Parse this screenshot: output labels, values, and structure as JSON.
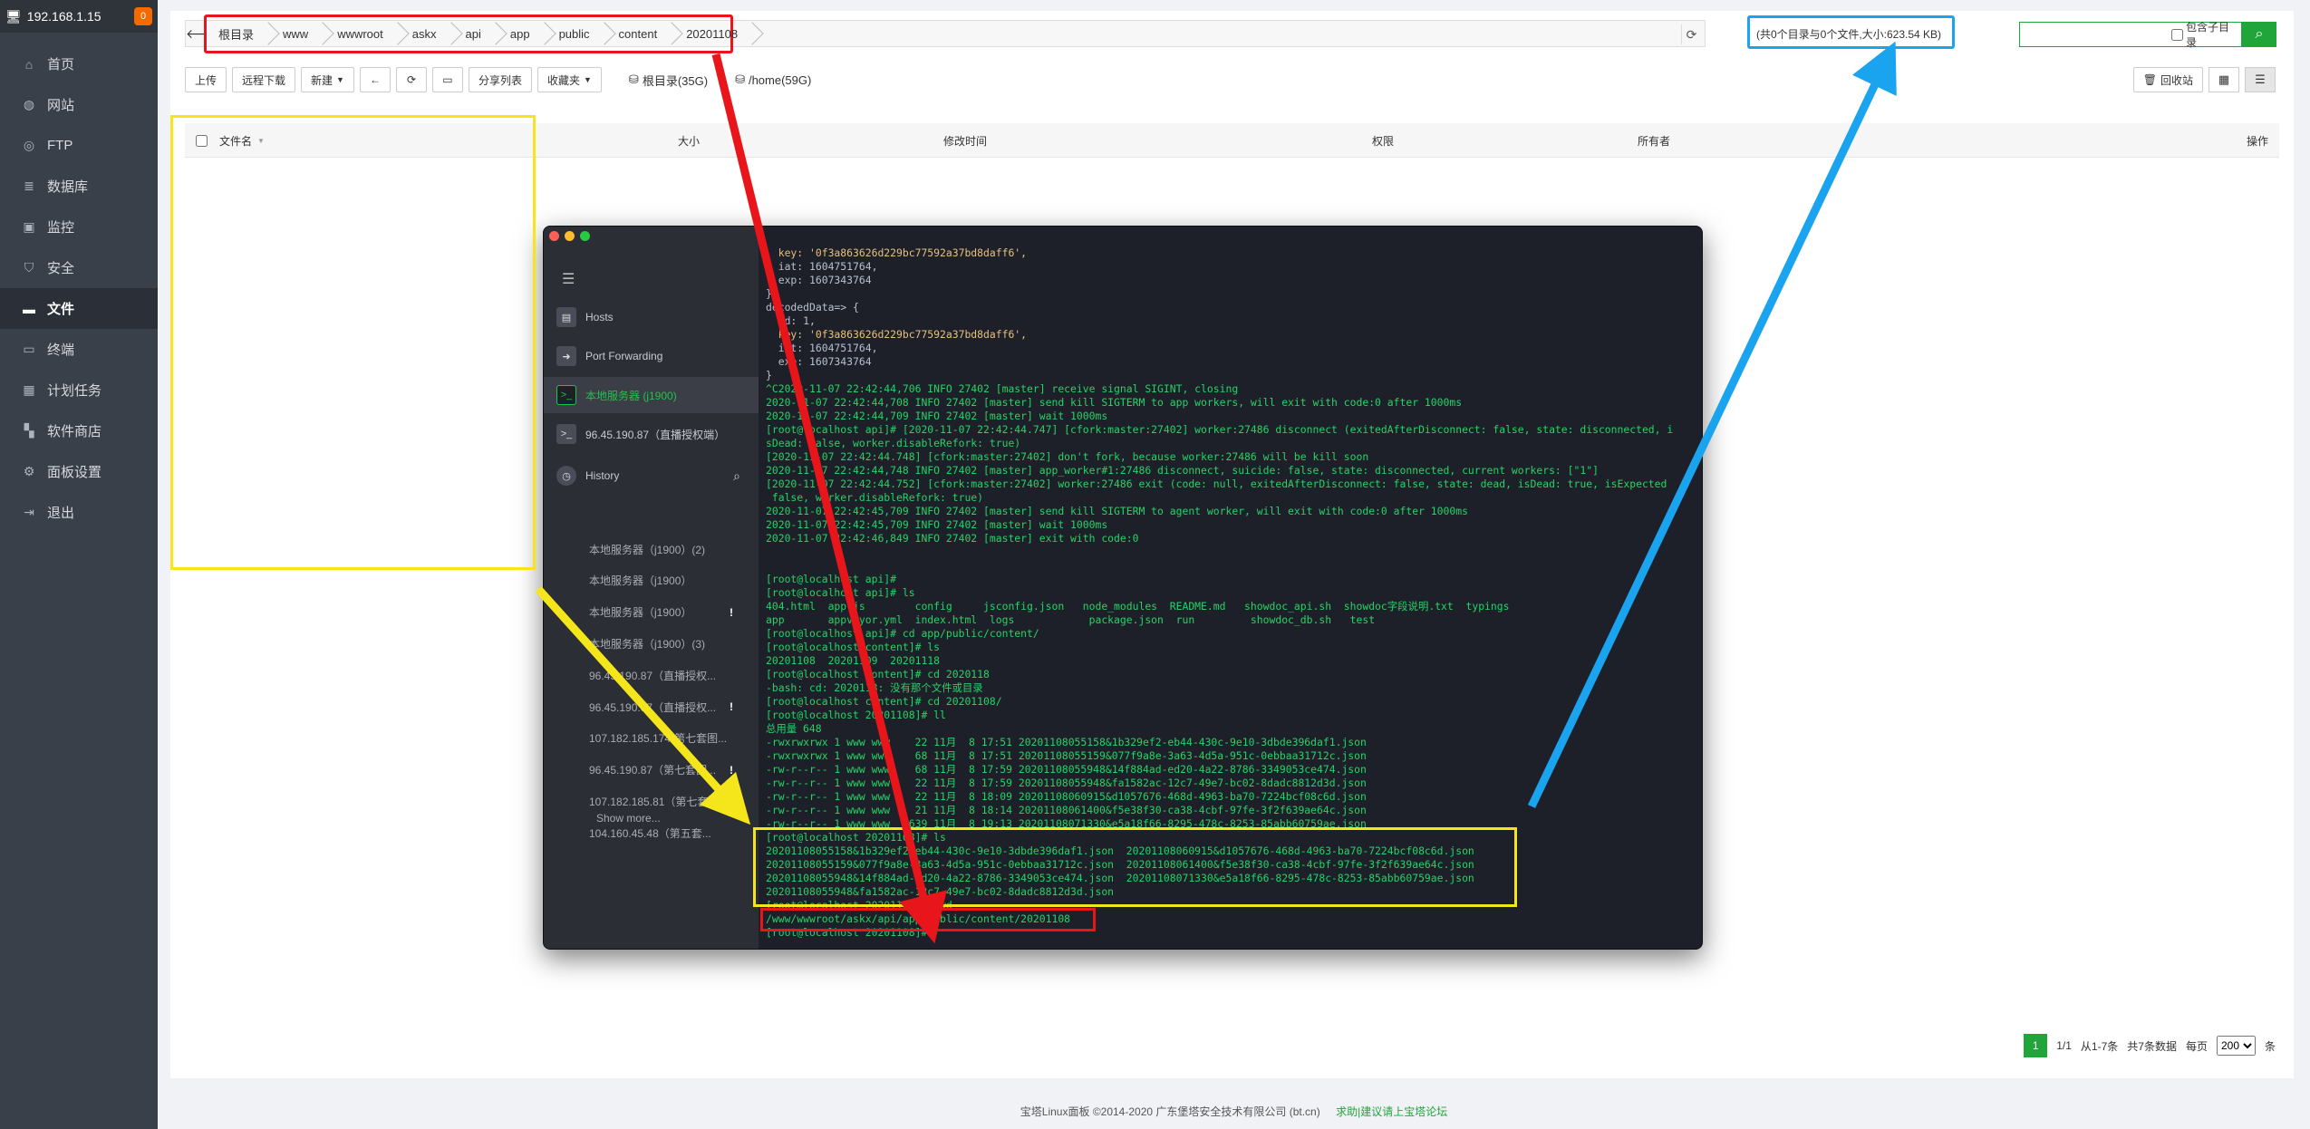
{
  "sidebar": {
    "host": "192.168.1.15",
    "badge": "0",
    "items": [
      {
        "label": "首页",
        "icon": "home-icon"
      },
      {
        "label": "网站",
        "icon": "globe-icon"
      },
      {
        "label": "FTP",
        "icon": "ftp-icon"
      },
      {
        "label": "数据库",
        "icon": "database-icon"
      },
      {
        "label": "监控",
        "icon": "monitor-icon"
      },
      {
        "label": "安全",
        "icon": "shield-icon"
      },
      {
        "label": "文件",
        "icon": "folder-icon",
        "active": true
      },
      {
        "label": "终端",
        "icon": "terminal-icon"
      },
      {
        "label": "计划任务",
        "icon": "calendar-icon"
      },
      {
        "label": "软件商店",
        "icon": "apps-icon"
      },
      {
        "label": "面板设置",
        "icon": "settings-icon"
      },
      {
        "label": "退出",
        "icon": "logout-icon"
      }
    ]
  },
  "path": {
    "crumbs": [
      "根目录",
      "www",
      "wwwroot",
      "askx",
      "api",
      "app",
      "public",
      "content",
      "20201108"
    ],
    "info": "(共0个目录与0个文件,大小:623.54 KB)"
  },
  "search": {
    "placeholder": "",
    "subdir_label": "包含子目录"
  },
  "toolbar": {
    "upload": "上传",
    "remote_download": "远程下载",
    "new": "新建",
    "share_list": "分享列表",
    "favorites": "收藏夹",
    "disk1": "根目录(35G)",
    "disk2": "/home(59G)",
    "recycle": "回收站"
  },
  "table": {
    "headers": {
      "name": "文件名",
      "size": "大小",
      "mtime": "修改时间",
      "perm": "权限",
      "owner": "所有者",
      "ops": "操作"
    }
  },
  "pager": {
    "page": "1",
    "total_pages": "1/1",
    "range": "从1-7条",
    "total": "共7条数据",
    "per_page_label": "每页",
    "per_page": "200",
    "unit": "条"
  },
  "footer": {
    "text": "宝塔Linux面板 ©2014-2020 广东堡塔安全技术有限公司 (bt.cn)",
    "link": "求助|建议请上宝塔论坛"
  },
  "terminal": {
    "nav": [
      {
        "label": "Hosts",
        "icon": "hosts-icon"
      },
      {
        "label": "Port Forwarding",
        "icon": "forward-icon"
      },
      {
        "label": "本地服务器 (j1900)",
        "icon": "prompt-icon",
        "selected": true
      },
      {
        "label": "96.45.190.87（直播授权端）",
        "icon": "prompt-icon"
      }
    ],
    "history_label": "History",
    "history": [
      {
        "label": "本地服务器（j1900）(2)",
        "warn": ""
      },
      {
        "label": "本地服务器（j1900）",
        "warn": ""
      },
      {
        "label": "本地服务器（j1900）",
        "warn": "!"
      },
      {
        "label": "本地服务器（j1900）(3)",
        "warn": ""
      },
      {
        "label": "96.45.190.87（直播授权...",
        "warn": ""
      },
      {
        "label": "96.45.190.87（直播授权...",
        "warn": "!"
      },
      {
        "label": "107.182.185.174(第七套图...",
        "warn": ""
      },
      {
        "label": "96.45.190.87（第七套图...",
        "warn": "!"
      },
      {
        "label": "107.182.185.81（第七套...",
        "warn": ""
      },
      {
        "label": "104.160.45.48（第五套...",
        "warn": ""
      }
    ],
    "show_more": "Show more...",
    "lines": [
      {
        "t": "  key: '0f3a863626d229bc77592a37bd8daff6',",
        "c": "y"
      },
      {
        "t": "  iat: 1604751764,",
        "c": ""
      },
      {
        "t": "  exp: 1607343764",
        "c": ""
      },
      {
        "t": "}",
        "c": ""
      },
      {
        "t": "decodedData=> {",
        "c": ""
      },
      {
        "t": "  id: 1,",
        "c": ""
      },
      {
        "t": "  key: '0f3a863626d229bc77592a37bd8daff6',",
        "c": "y"
      },
      {
        "t": "  iat: 1604751764,",
        "c": ""
      },
      {
        "t": "  exp: 1607343764",
        "c": ""
      },
      {
        "t": "}",
        "c": ""
      },
      {
        "t": "^C2020-11-07 22:42:44,706 INFO 27402 [master] receive signal SIGINT, closing",
        "c": "g"
      },
      {
        "t": "2020-11-07 22:42:44,708 INFO 27402 [master] send kill SIGTERM to app workers, will exit with code:0 after 1000ms",
        "c": "g"
      },
      {
        "t": "2020-11-07 22:42:44,709 INFO 27402 [master] wait 1000ms",
        "c": "g"
      },
      {
        "t": "[root@localhost api]# [2020-11-07 22:42:44.747] [cfork:master:27402] worker:27486 disconnect (exitedAfterDisconnect: false, state: disconnected, i",
        "c": "g"
      },
      {
        "t": "sDead: false, worker.disableRefork: true)",
        "c": "g"
      },
      {
        "t": "[2020-11-07 22:42:44.748] [cfork:master:27402] don't fork, because worker:27486 will be kill soon",
        "c": "g"
      },
      {
        "t": "2020-11-07 22:42:44,748 INFO 27402 [master] app_worker#1:27486 disconnect, suicide: false, state: disconnected, current workers: [\"1\"]",
        "c": "g"
      },
      {
        "t": "[2020-11-07 22:42:44.752] [cfork:master:27402] worker:27486 exit (code: null, exitedAfterDisconnect: false, state: dead, isDead: true, isExpected",
        "c": "g"
      },
      {
        "t": " false, worker.disableRefork: true)",
        "c": "g"
      },
      {
        "t": "2020-11-07 22:42:45,709 INFO 27402 [master] send kill SIGTERM to agent worker, will exit with code:0 after 1000ms",
        "c": "g"
      },
      {
        "t": "2020-11-07 22:42:45,709 INFO 27402 [master] wait 1000ms",
        "c": "g"
      },
      {
        "t": "2020-11-07 22:42:46,849 INFO 27402 [master] exit with code:0",
        "c": "g"
      },
      {
        "t": "",
        "c": ""
      },
      {
        "t": "",
        "c": ""
      },
      {
        "t": "[root@localhost api]#",
        "c": "g"
      },
      {
        "t": "[root@localhost api]# ls",
        "c": "g"
      },
      {
        "t": "404.html  app.js        config     jsconfig.json   node_modules  README.md   showdoc_api.sh  showdoc字段说明.txt  typings",
        "c": "g"
      },
      {
        "t": "app       appveyor.yml  index.html  logs            package.json  run         showdoc_db.sh   test",
        "c": "g"
      },
      {
        "t": "[root@localhost api]# cd app/public/content/",
        "c": "g"
      },
      {
        "t": "[root@localhost content]# ls",
        "c": "g"
      },
      {
        "t": "20201108  20201109  20201118",
        "c": "g"
      },
      {
        "t": "[root@localhost content]# cd 2020118",
        "c": "g"
      },
      {
        "t": "-bash: cd: 2020118: 没有那个文件或目录",
        "c": "g"
      },
      {
        "t": "[root@localhost content]# cd 20201108/",
        "c": "g"
      },
      {
        "t": "[root@localhost 20201108]# ll",
        "c": "g"
      },
      {
        "t": "总用量 648",
        "c": "g"
      },
      {
        "t": "-rwxrwxrwx 1 www www    22 11月  8 17:51 20201108055158&1b329ef2-eb44-430c-9e10-3dbde396daf1.json",
        "c": "g"
      },
      {
        "t": "-rwxrwxrwx 1 www www    68 11月  8 17:51 20201108055159&077f9a8e-3a63-4d5a-951c-0ebbaa31712c.json",
        "c": "g"
      },
      {
        "t": "-rw-r--r-- 1 www www    68 11月  8 17:59 20201108055948&14f884ad-ed20-4a22-8786-3349053ce474.json",
        "c": "g"
      },
      {
        "t": "-rw-r--r-- 1 www www    22 11月  8 17:59 20201108055948&fa1582ac-12c7-49e7-bc02-8dadc8812d3d.json",
        "c": "g"
      },
      {
        "t": "-rw-r--r-- 1 www www    22 11月  8 18:09 20201108060915&d1057676-468d-4963-ba70-7224bcf08c6d.json",
        "c": "g"
      },
      {
        "t": "-rw-r--r-- 1 www www    21 11月  8 18:14 20201108061400&f5e38f30-ca38-4cbf-97fe-3f2f639ae64c.json",
        "c": "g"
      },
      {
        "t": "-rw-r--r-- 1 www www   639 11月  8 19:13 20201108071330&e5a18f66-8295-478c-8253-85abb60759ae.json",
        "c": "g"
      },
      {
        "t": "[root@localhost 20201108]# ls",
        "c": "g"
      },
      {
        "t": "20201108055158&1b329ef2-eb44-430c-9e10-3dbde396daf1.json  20201108060915&d1057676-468d-4963-ba70-7224bcf08c6d.json",
        "c": "g"
      },
      {
        "t": "20201108055159&077f9a8e-3a63-4d5a-951c-0ebbaa31712c.json  20201108061400&f5e38f30-ca38-4cbf-97fe-3f2f639ae64c.json",
        "c": "g"
      },
      {
        "t": "20201108055948&14f884ad-ed20-4a22-8786-3349053ce474.json  20201108071330&e5a18f66-8295-478c-8253-85abb60759ae.json",
        "c": "g"
      },
      {
        "t": "20201108055948&fa1582ac-12c7-49e7-bc02-8dadc8812d3d.json",
        "c": "g"
      },
      {
        "t": "[root@localhost 20201108]# pwd",
        "c": "g"
      },
      {
        "t": "/www/wwwroot/askx/api/app/public/content/20201108",
        "c": "g"
      },
      {
        "t": "[root@localhost 20201108]# ",
        "c": "g"
      }
    ]
  },
  "colors": {
    "accent": "#20a53a",
    "sidebar": "#3a4049",
    "annotation_red": "#e8151b",
    "annotation_yellow": "#f5e61b",
    "annotation_blue": "#1aa3ef"
  }
}
